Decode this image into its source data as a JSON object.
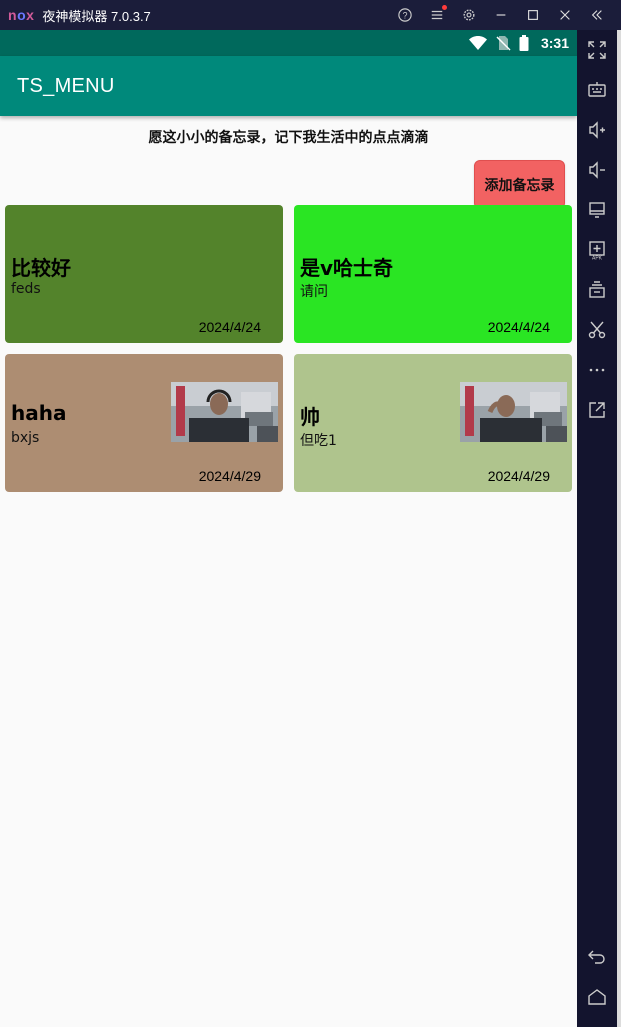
{
  "window": {
    "logo": "nox",
    "title": "夜神模拟器 7.0.3.7",
    "icons": [
      "help-icon",
      "menu-icon",
      "settings-icon",
      "minimize-icon",
      "maximize-icon",
      "close-icon",
      "collapse-icon"
    ]
  },
  "statusbar": {
    "time": "3:31"
  },
  "appbar": {
    "title": "TS_MENU"
  },
  "main": {
    "motto": "愿这小小的备忘录，记下我生活中的点点滴滴",
    "add_button": "添加备忘录"
  },
  "memos": [
    {
      "title": "比较好",
      "content": "feds",
      "date": "2024/4/24",
      "color": "#53832b",
      "has_image": false
    },
    {
      "title": "是v哈士奇",
      "content": "请问",
      "date": "2024/4/24",
      "color": "#2ae523",
      "has_image": false
    },
    {
      "title": "haha",
      "content": "bxjs",
      "date": "2024/4/29",
      "color": "#ad8d72",
      "has_image": true
    },
    {
      "title": "帅",
      "content": "但吃1",
      "date": "2024/4/29",
      "color": "#afc48d",
      "has_image": true
    }
  ],
  "sidebar": {
    "tools": [
      "fullscreen-icon",
      "keyboard-icon",
      "volume-up-icon",
      "volume-down-icon",
      "screen-icon",
      "apk-install-icon",
      "multi-instance-icon",
      "scissors-icon",
      "more-icon",
      "open-external-icon"
    ],
    "nav": [
      "back-icon",
      "home-icon"
    ]
  }
}
